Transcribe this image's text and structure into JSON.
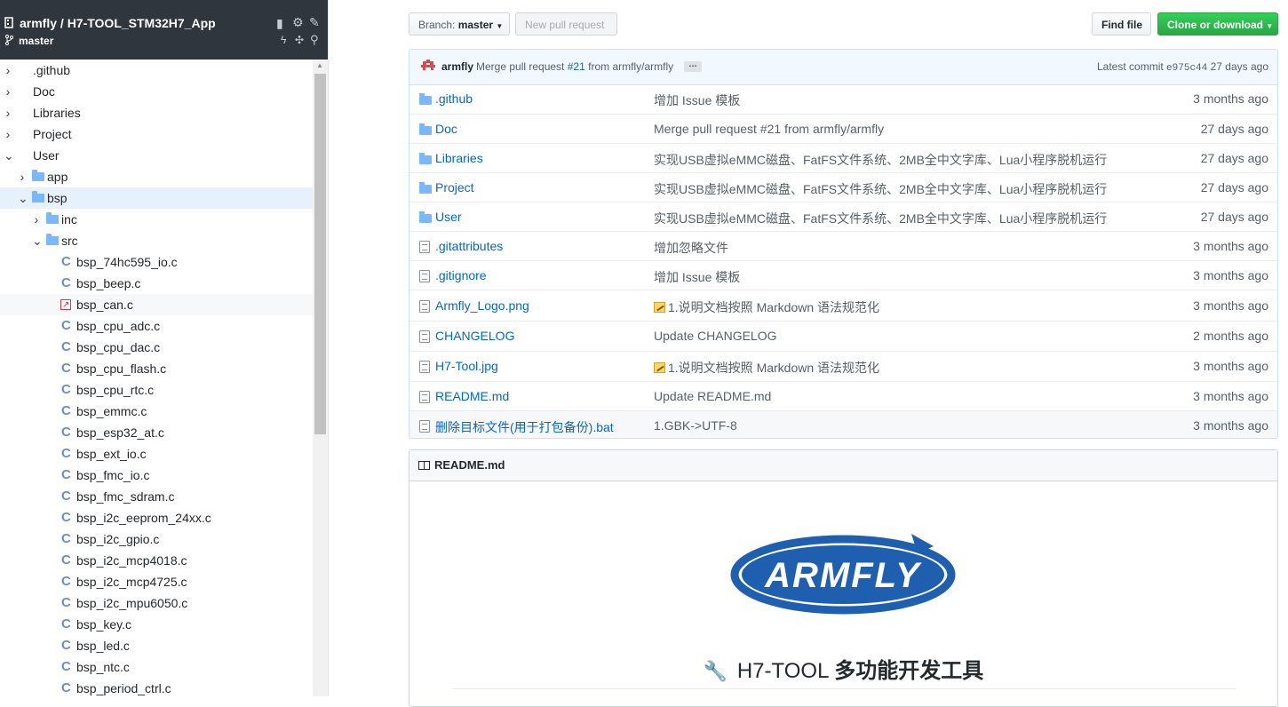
{
  "sidebar": {
    "repo_title": "armfly / H7-TOOL_STM32H7_App",
    "branch": "master",
    "tree": [
      {
        "label": ".github",
        "type": "dir",
        "depth": 0,
        "open": false
      },
      {
        "label": "Doc",
        "type": "dir",
        "depth": 0,
        "open": false
      },
      {
        "label": "Libraries",
        "type": "dir",
        "depth": 0,
        "open": false
      },
      {
        "label": "Project",
        "type": "dir",
        "depth": 0,
        "open": false
      },
      {
        "label": "User",
        "type": "dir",
        "depth": 0,
        "open": true
      },
      {
        "label": "app",
        "type": "folder",
        "depth": 1,
        "open": false
      },
      {
        "label": "bsp",
        "type": "folder",
        "depth": 1,
        "open": true,
        "selected": true
      },
      {
        "label": "inc",
        "type": "folder",
        "depth": 2,
        "open": false
      },
      {
        "label": "src",
        "type": "folder",
        "depth": 2,
        "open": true
      },
      {
        "label": "bsp_74hc595_io.c",
        "type": "c",
        "depth": 3
      },
      {
        "label": "bsp_beep.c",
        "type": "c",
        "depth": 3
      },
      {
        "label": "bsp_can.c",
        "type": "img",
        "depth": 3,
        "hover": true
      },
      {
        "label": "bsp_cpu_adc.c",
        "type": "c",
        "depth": 3
      },
      {
        "label": "bsp_cpu_dac.c",
        "type": "c",
        "depth": 3
      },
      {
        "label": "bsp_cpu_flash.c",
        "type": "c",
        "depth": 3
      },
      {
        "label": "bsp_cpu_rtc.c",
        "type": "c",
        "depth": 3
      },
      {
        "label": "bsp_emmc.c",
        "type": "c",
        "depth": 3
      },
      {
        "label": "bsp_esp32_at.c",
        "type": "c",
        "depth": 3
      },
      {
        "label": "bsp_ext_io.c",
        "type": "c",
        "depth": 3
      },
      {
        "label": "bsp_fmc_io.c",
        "type": "c",
        "depth": 3
      },
      {
        "label": "bsp_fmc_sdram.c",
        "type": "c",
        "depth": 3
      },
      {
        "label": "bsp_i2c_eeprom_24xx.c",
        "type": "c",
        "depth": 3
      },
      {
        "label": "bsp_i2c_gpio.c",
        "type": "c",
        "depth": 3
      },
      {
        "label": "bsp_i2c_mcp4018.c",
        "type": "c",
        "depth": 3
      },
      {
        "label": "bsp_i2c_mcp4725.c",
        "type": "c",
        "depth": 3
      },
      {
        "label": "bsp_i2c_mpu6050.c",
        "type": "c",
        "depth": 3
      },
      {
        "label": "bsp_key.c",
        "type": "c",
        "depth": 3
      },
      {
        "label": "bsp_led.c",
        "type": "c",
        "depth": 3
      },
      {
        "label": "bsp_ntc.c",
        "type": "c",
        "depth": 3
      },
      {
        "label": "bsp_period_ctrl.c",
        "type": "c",
        "depth": 3
      }
    ]
  },
  "toolbar": {
    "branch_prefix": "Branch:",
    "branch_name": "master",
    "new_pr_label": "New pull request",
    "find_file_label": "Find file",
    "clone_label": "Clone or download"
  },
  "commit": {
    "author": "armfly",
    "message_prefix": "Merge pull request",
    "pr_link": "#21",
    "message_suffix": "from armfly/armfly",
    "more": "…",
    "latest_label": "Latest commit",
    "sha": "e975c44",
    "age": "27 days ago"
  },
  "files": [
    {
      "name": ".github",
      "kind": "dir",
      "message": "增加 Issue 模板",
      "age": "3 months ago"
    },
    {
      "name": "Doc",
      "kind": "dir",
      "message": "Merge pull request #21 from armfly/armfly",
      "age": "27 days ago"
    },
    {
      "name": "Libraries",
      "kind": "dir",
      "message": "实现USB虚拟eMMC磁盘、FatFS文件系统、2MB全中文字库、Lua小程序脱机运行",
      "age": "27 days ago"
    },
    {
      "name": "Project",
      "kind": "dir",
      "message": "实现USB虚拟eMMC磁盘、FatFS文件系统、2MB全中文字库、Lua小程序脱机运行",
      "age": "27 days ago"
    },
    {
      "name": "User",
      "kind": "dir",
      "message": "实现USB虚拟eMMC磁盘、FatFS文件系统、2MB全中文字库、Lua小程序脱机运行",
      "age": "27 days ago"
    },
    {
      "name": ".gitattributes",
      "kind": "file",
      "message": "增加忽略文件",
      "age": "3 months ago"
    },
    {
      "name": ".gitignore",
      "kind": "file",
      "message": "增加 Issue 模板",
      "age": "3 months ago"
    },
    {
      "name": "Armfly_Logo.png",
      "kind": "file",
      "message": "1.说明文档按照 Markdown 语法规范化",
      "memo": true,
      "age": "3 months ago"
    },
    {
      "name": "CHANGELOG",
      "kind": "file",
      "message": "Update CHANGELOG",
      "age": "2 months ago"
    },
    {
      "name": "H7-Tool.jpg",
      "kind": "file",
      "message": "1.说明文档按照 Markdown 语法规范化",
      "memo": true,
      "age": "3 months ago"
    },
    {
      "name": "README.md",
      "kind": "file",
      "message": "Update README.md",
      "age": "3 months ago"
    },
    {
      "name": "删除目标文件(用于打包备份).bat",
      "kind": "file",
      "message": "1.GBK->UTF-8",
      "age": "3 months ago"
    }
  ],
  "readme": {
    "title": "README.md",
    "logo_text": "ARMFLY",
    "heading_en": "H7-TOOL",
    "heading_zh": "多功能开发工具",
    "colors": {
      "logo_blue": "#1f5fb0"
    }
  }
}
